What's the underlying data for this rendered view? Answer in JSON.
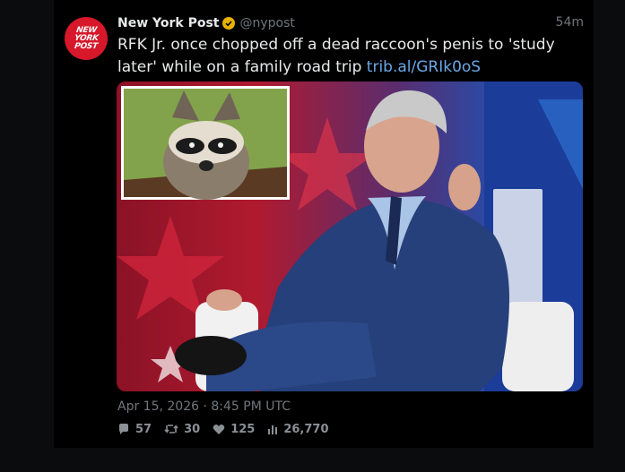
{
  "tweet": {
    "author_name": "New York Post",
    "handle": "@nypost",
    "time_ago": "54m",
    "text": "RFK Jr. once chopped off a dead raccoon's penis to 'study later' while on a family road trip",
    "link": "trib.al/GRIk0oS",
    "timestamp": "Apr 15, 2026 · 8:45 PM UTC"
  },
  "avatar": {
    "line1": "NEW",
    "line2": "YORK",
    "line3": "POST",
    "bg": "#d6182a"
  },
  "stats": {
    "replies": "57",
    "retweets": "30",
    "likes": "125",
    "views": "26,770"
  },
  "icons": {
    "verified": "verified-badge-icon",
    "reply": "comment-bubble-icon",
    "retweet": "retweet-icon",
    "like": "heart-icon",
    "views": "bar-chart-icon"
  },
  "colors": {
    "link": "#6aa8e6",
    "verified": "#e8b100",
    "muted": "#71767b",
    "background": "#000000"
  }
}
